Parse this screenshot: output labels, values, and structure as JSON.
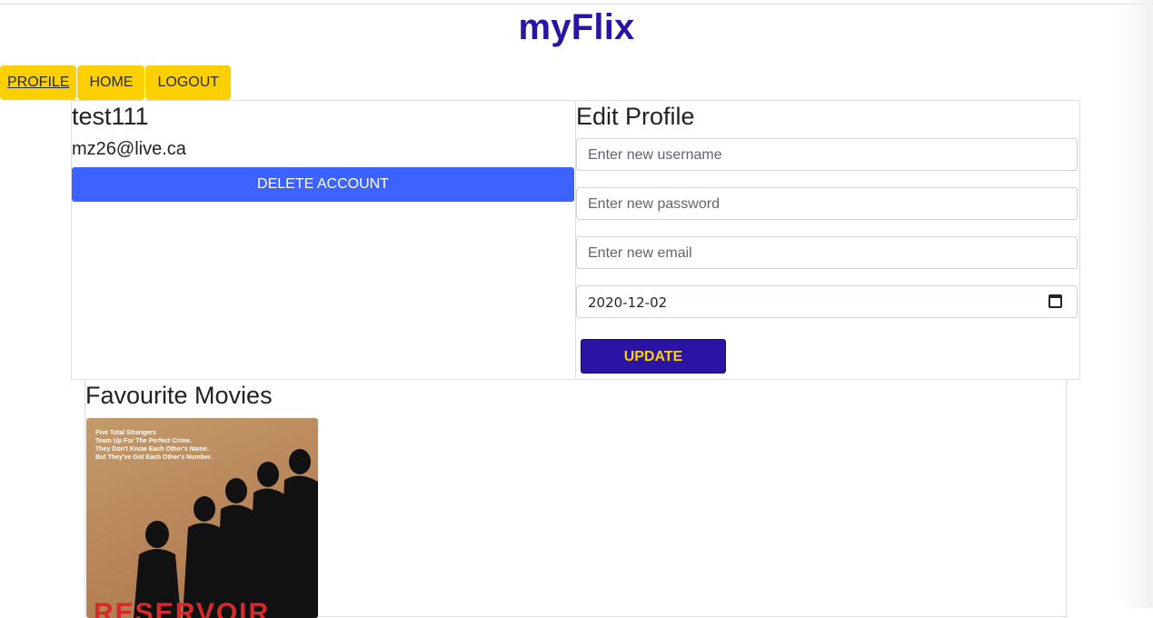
{
  "brand": "myFlix",
  "nav": {
    "profile": "PROFILE",
    "home": "HOME",
    "logout": "LOGOUT"
  },
  "user": {
    "username": "test111",
    "email": "mz26@live.ca",
    "delete_label": "DELETE ACCOUNT"
  },
  "edit": {
    "title": "Edit Profile",
    "username_placeholder": "Enter new username",
    "password_placeholder": "Enter new password",
    "email_placeholder": "Enter new email",
    "birthday_value": "2020-12-02",
    "update_label": "UPDATE"
  },
  "favourites": {
    "title": "Favourite Movies",
    "movies": [
      {
        "tagline": "Five Total Strangers\nTeam Up For The Perfect Crime.\nThey Don't Know Each Other's Name.\nBut They've Got Each Other's Number.",
        "title_fragment": "RESERVOIR"
      }
    ]
  },
  "colors": {
    "brand": "#2a14a6",
    "nav_bg": "#fcd000",
    "danger": "#3c62ff",
    "update_bg": "#2a14a6",
    "update_text": "#fcd000"
  }
}
